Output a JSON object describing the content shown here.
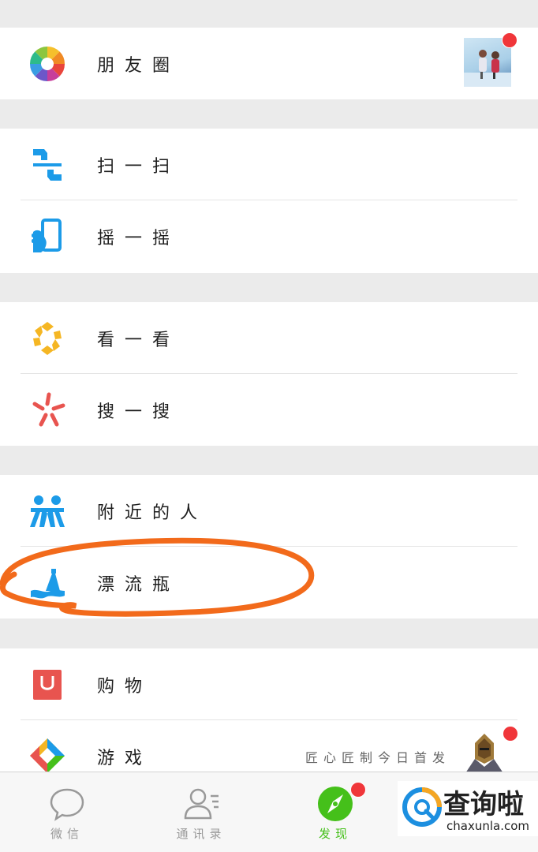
{
  "menu": {
    "moments": {
      "label": "朋友圈",
      "icon": "moments-aperture-icon"
    },
    "scan": {
      "label": "扫一扫",
      "icon": "scan-icon"
    },
    "shake": {
      "label": "摇一摇",
      "icon": "shake-phone-icon"
    },
    "look": {
      "label": "看一看",
      "icon": "look-hexagon-icon"
    },
    "search": {
      "label": "搜一搜",
      "icon": "search-star-icon"
    },
    "nearby": {
      "label": "附近的人",
      "icon": "people-nearby-icon"
    },
    "bottle": {
      "label": "漂流瓶",
      "icon": "drift-bottle-icon"
    },
    "shopping": {
      "label": "购物",
      "icon": "shopping-bag-icon"
    },
    "games": {
      "label": "游戏",
      "icon": "games-icon"
    }
  },
  "games_promo": {
    "text": "匠心匠制今日首发"
  },
  "tabs": [
    {
      "label": "微信",
      "icon": "chat-bubble-icon"
    },
    {
      "label": "通讯录",
      "icon": "contacts-icon"
    },
    {
      "label": "发现",
      "icon": "compass-icon"
    }
  ],
  "brand": {
    "title": "查询啦",
    "sub": "chaxunla.com"
  },
  "colors": {
    "active": "#45c01a",
    "badge": "#f0363a",
    "highlight": "#f26a1b"
  }
}
